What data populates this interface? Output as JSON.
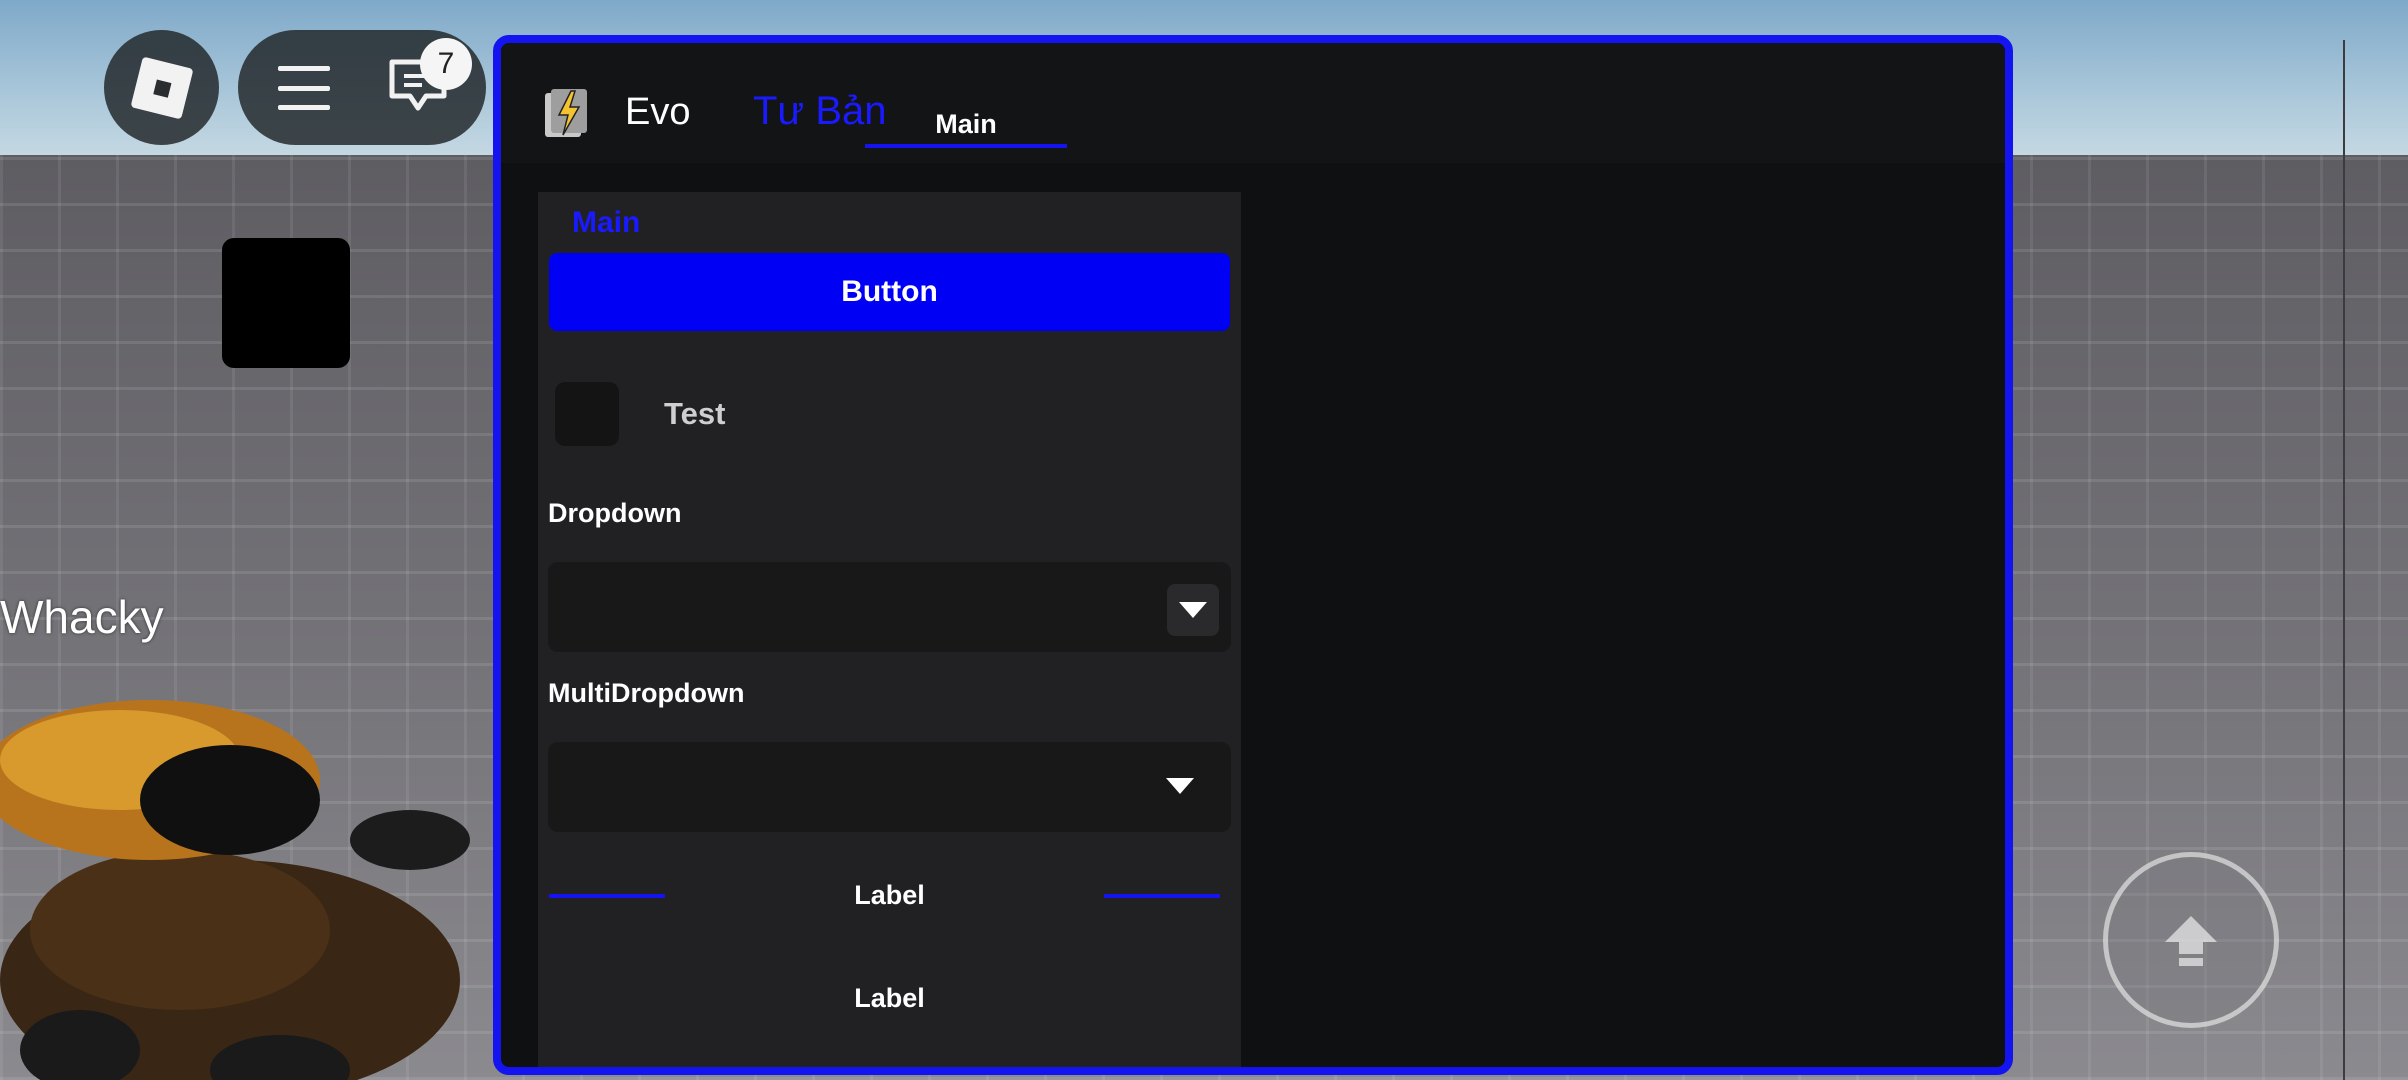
{
  "game": {
    "player_name": "Whacky",
    "chat_badge_count": "7"
  },
  "window": {
    "title": "Evo",
    "subtitle": "Tư Bản",
    "active_tab": "Main",
    "accent_color": "#1414f0"
  },
  "panel": {
    "title": "Main",
    "button_label": "Button",
    "toggle": {
      "label": "Test",
      "checked": false
    },
    "dropdown": {
      "label": "Dropdown",
      "value": ""
    },
    "multi_dropdown": {
      "label": "MultiDropdown",
      "value": ""
    },
    "divider_label": "Label",
    "label": "Label"
  },
  "icons": [
    "roblox-logo-icon",
    "menu-icon",
    "chat-icon",
    "evo-app-icon",
    "chevron-down-icon",
    "jump-arrow-icon"
  ]
}
